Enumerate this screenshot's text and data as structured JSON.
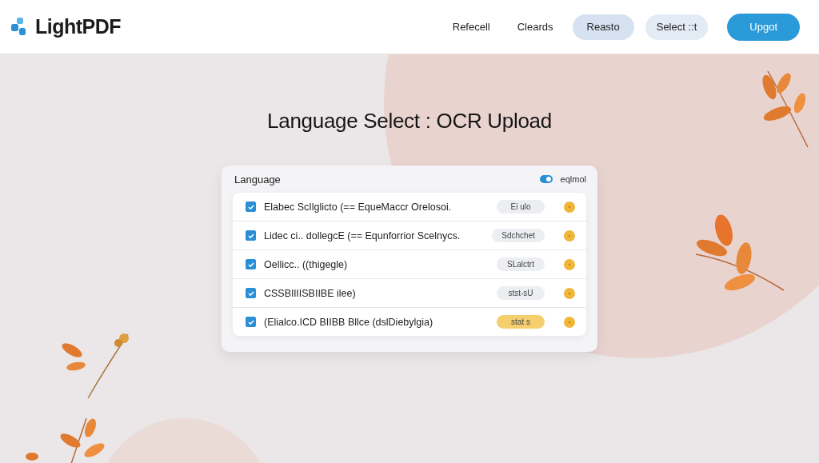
{
  "header": {
    "logo": "LightPDF",
    "nav": [
      {
        "label": "Refecell",
        "kind": "link"
      },
      {
        "label": "Cleards",
        "kind": "link"
      },
      {
        "label": "Reasto",
        "kind": "pill-strong"
      },
      {
        "label": "Select ::t",
        "kind": "pill"
      },
      {
        "label": "Upgot",
        "kind": "primary"
      }
    ]
  },
  "title": "Language Select : OCR Upload",
  "panel": {
    "heading": "Language",
    "toggle": {
      "label": "eqlmol",
      "on": true
    },
    "rows": [
      {
        "label": "Elabec ScIlglicto (== EqueMaccr Orelosoi.",
        "tag": "Ei ulo",
        "color": "#eceef2",
        "checked": true
      },
      {
        "label": "Lidec ci.. dollegcE (== Equnforrior Scelnycs.",
        "tag": "Sdchchet",
        "color": "#eceef2",
        "checked": true
      },
      {
        "label": "Oellicc.. ((thigegle)",
        "tag": "SLalctrt",
        "color": "#eceef2",
        "checked": true
      },
      {
        "label": "CSSBIlIISBIIBE ilee)",
        "tag": "stst-sU",
        "color": "#eceef2",
        "checked": true
      },
      {
        "label": "(Elialco.ICD BIIBB Bllce (dslDiebylgia)",
        "tag": "stat s",
        "color": "#f5cf6e",
        "checked": true
      }
    ]
  }
}
